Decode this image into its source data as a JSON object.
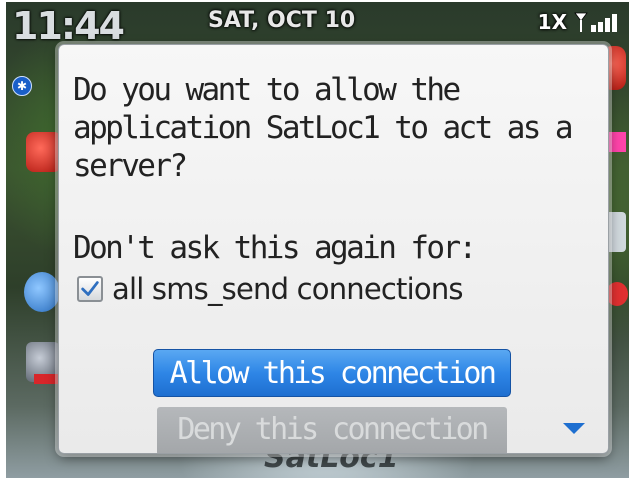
{
  "status_bar": {
    "time": "11:44",
    "date": "SAT, OCT 10",
    "network": "1X"
  },
  "home_screen": {
    "app_label": "SatLoc1"
  },
  "dialog": {
    "message": "Do you want to allow the\napplication SatLoc1 to act as a\nserver?",
    "dont_ask_label": "Don't ask this again for:",
    "checkbox": {
      "label": "all sms_send connections",
      "checked": true
    },
    "allow_button": "Allow this connection",
    "deny_button": "Deny this connection"
  },
  "colors": {
    "accent": "#2e86e6",
    "dialog_bg": "#f2f2f2",
    "deny_bg": "#a9acaf"
  },
  "icons": [
    "bluetooth-icon",
    "signal-strength-icon",
    "checkmark-icon",
    "scroll-down-arrow-icon"
  ]
}
